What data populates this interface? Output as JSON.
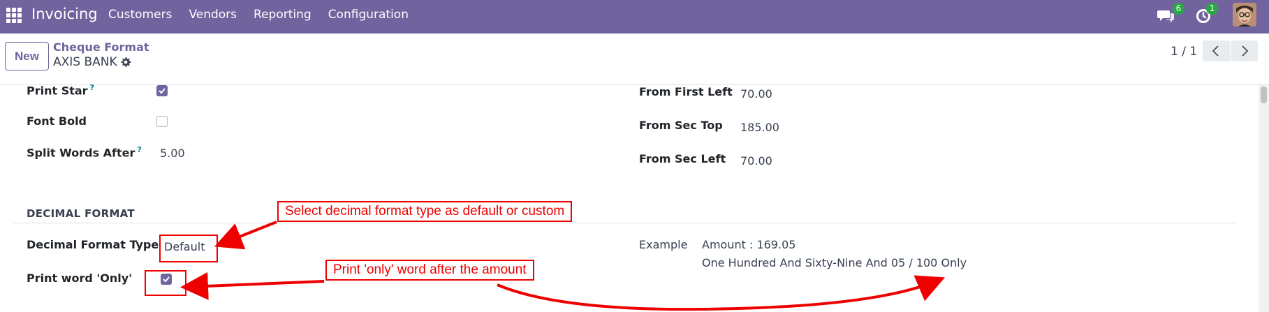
{
  "nav": {
    "brand": "Invoicing",
    "menu": [
      "Customers",
      "Vendors",
      "Reporting",
      "Configuration"
    ],
    "messages_count": "6",
    "activities_count": "1"
  },
  "control": {
    "new_label": "New",
    "breadcrumb_parent": "Cheque Format",
    "breadcrumb_current": "AXIS BANK",
    "pager": "1 / 1"
  },
  "form": {
    "print_star": {
      "label": "Print Star",
      "help": "?",
      "checked": true
    },
    "font_bold": {
      "label": "Font Bold",
      "checked": false
    },
    "split_words_after": {
      "label": "Split Words After",
      "help": "?",
      "value": "5.00"
    },
    "from_first_left": {
      "label": "From First Left",
      "value": "70.00"
    },
    "from_sec_top": {
      "label": "From Sec Top",
      "value": "185.00"
    },
    "from_sec_left": {
      "label": "From Sec Left",
      "value": "70.00"
    },
    "decimal_section": "DECIMAL FORMAT",
    "decimal_format_type": {
      "label": "Decimal Format Type",
      "value": "Default"
    },
    "print_word_only": {
      "label": "Print word 'Only'",
      "checked": true
    },
    "example": {
      "label": "Example",
      "amount": "Amount : 169.05",
      "words": "One Hundred And Sixty-Nine And 05 / 100 Only"
    }
  },
  "annotations": {
    "decimal_note": "Select decimal format type as default or custom",
    "only_note": "Print 'only' word after the amount"
  },
  "colors": {
    "brand": "#71639e",
    "annotation": "#e00000",
    "badge": "#28a745"
  }
}
